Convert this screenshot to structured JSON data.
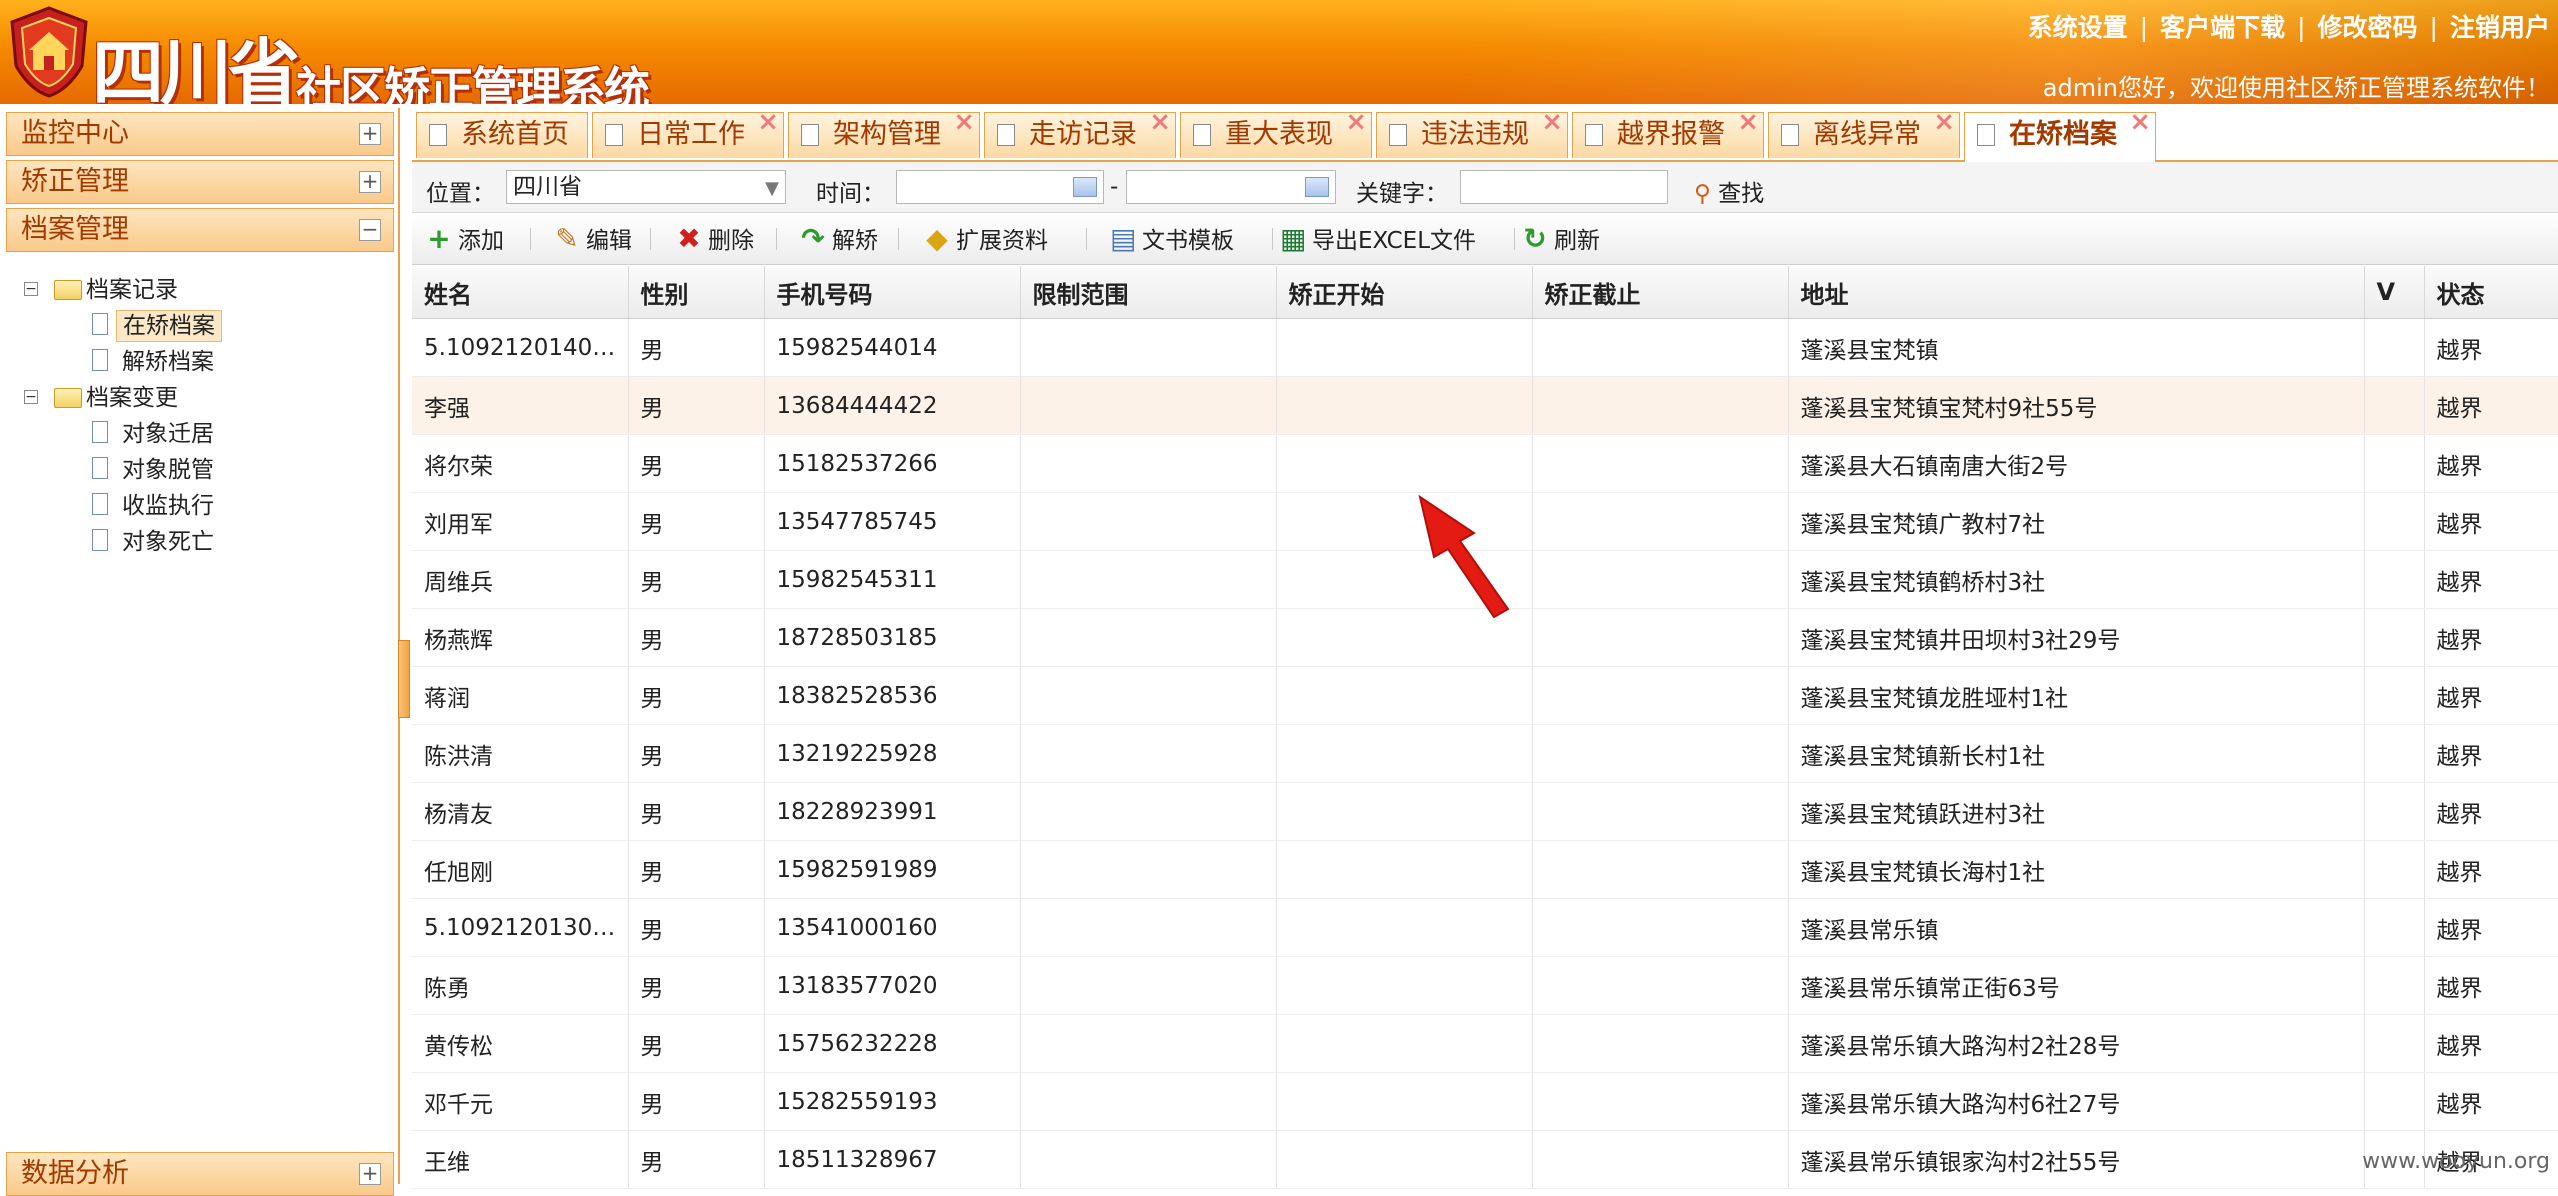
{
  "header": {
    "title_big": "四川省",
    "title_small": "社区矫正管理系统",
    "nav": [
      "系统设置",
      "客户端下载",
      "修改密码",
      "注销用户"
    ],
    "welcome": "admin您好，欢迎使用社区矫正管理系统软件！",
    "accent": "#f58a00"
  },
  "sidebar": {
    "sections": [
      {
        "label": "监控中心",
        "toggle": "+"
      },
      {
        "label": "矫正管理",
        "toggle": "+"
      },
      {
        "label": "档案管理",
        "toggle": "−"
      },
      {
        "label": "数据分析",
        "toggle": "+"
      }
    ],
    "tree": {
      "group1": {
        "label": "档案记录",
        "items": [
          "在矫档案",
          "解矫档案"
        ],
        "selected": "在矫档案"
      },
      "group2": {
        "label": "档案变更",
        "items": [
          "对象迁居",
          "对象脱管",
          "收监执行",
          "对象死亡"
        ]
      }
    }
  },
  "tabs": [
    {
      "label": "系统首页",
      "closable": false
    },
    {
      "label": "日常工作",
      "closable": true
    },
    {
      "label": "架构管理",
      "closable": true
    },
    {
      "label": "走访记录",
      "closable": true
    },
    {
      "label": "重大表现",
      "closable": true
    },
    {
      "label": "违法违规",
      "closable": true
    },
    {
      "label": "越界报警",
      "closable": true
    },
    {
      "label": "离线异常",
      "closable": true
    },
    {
      "label": "在矫档案",
      "closable": true,
      "active": true
    }
  ],
  "search": {
    "location_label": "位置：",
    "location_value": "四川省",
    "time_label": "时间：",
    "dash": "-",
    "keyword_label": "关键字：",
    "search_button": "查找"
  },
  "toolbar": {
    "add": "添加",
    "edit": "编辑",
    "delete": "删除",
    "release": "解矫",
    "extend": "扩展资料",
    "docs": "文书模板",
    "export": "导出EXCEL文件",
    "refresh": "刷新"
  },
  "grid": {
    "columns": [
      "姓名",
      "性别",
      "手机号码",
      "限制范围",
      "矫正开始",
      "矫正截止",
      "地址",
      "V",
      "状态"
    ],
    "rows": [
      [
        "5.10921201404...",
        "男",
        "15982544014",
        "",
        "",
        "",
        "蓬溪县宝梵镇",
        "",
        "越界"
      ],
      [
        "李强",
        "男",
        "13684444422",
        "",
        "",
        "",
        "蓬溪县宝梵镇宝梵村9社55号",
        "",
        "越界"
      ],
      [
        "将尔荣",
        "男",
        "15182537266",
        "",
        "",
        "",
        "蓬溪县大石镇南唐大街2号",
        "",
        "越界"
      ],
      [
        "刘用军",
        "男",
        "13547785745",
        "",
        "",
        "",
        "蓬溪县宝梵镇广教村7社",
        "",
        "越界"
      ],
      [
        "周维兵",
        "男",
        "15982545311",
        "",
        "",
        "",
        "蓬溪县宝梵镇鹤桥村3社",
        "",
        "越界"
      ],
      [
        "杨燕辉",
        "男",
        "18728503185",
        "",
        "",
        "",
        "蓬溪县宝梵镇井田坝村3社29号",
        "",
        "越界"
      ],
      [
        "蒋润",
        "男",
        "18382528536",
        "",
        "",
        "",
        "蓬溪县宝梵镇龙胜垭村1社",
        "",
        "越界"
      ],
      [
        "陈洪清",
        "男",
        "13219225928",
        "",
        "",
        "",
        "蓬溪县宝梵镇新长村1社",
        "",
        "越界"
      ],
      [
        "杨清友",
        "男",
        "18228923991",
        "",
        "",
        "",
        "蓬溪县宝梵镇跃进村3社",
        "",
        "越界"
      ],
      [
        "任旭刚",
        "男",
        "15982591989",
        "",
        "",
        "",
        "蓬溪县宝梵镇长海村1社",
        "",
        "越界"
      ],
      [
        "5.10921201309...",
        "男",
        "13541000160",
        "",
        "",
        "",
        "蓬溪县常乐镇",
        "",
        "越界"
      ],
      [
        "陈勇",
        "男",
        "13183577020",
        "",
        "",
        "",
        "蓬溪县常乐镇常正街63号",
        "",
        "越界"
      ],
      [
        "黄传松",
        "男",
        "15756232228",
        "",
        "",
        "",
        "蓬溪县常乐镇大路沟村2社28号",
        "",
        "越界"
      ],
      [
        "邓千元",
        "男",
        "15282559193",
        "",
        "",
        "",
        "蓬溪县常乐镇大路沟村6社27号",
        "",
        "越界"
      ],
      [
        "王维",
        "男",
        "18511328967",
        "",
        "",
        "",
        "蓬溪县常乐镇银家沟村2社55号",
        "",
        "越界"
      ]
    ]
  },
  "watermark": "www.wooyun.org"
}
